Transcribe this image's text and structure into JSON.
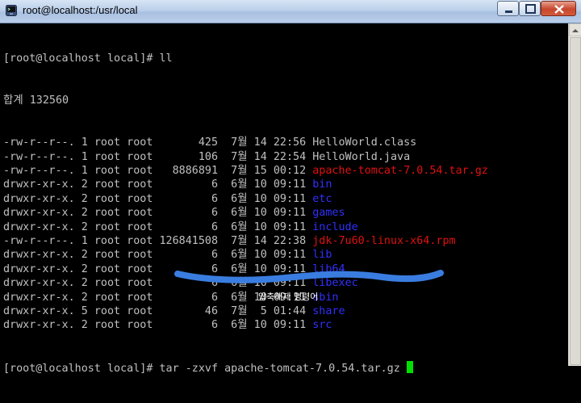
{
  "window": {
    "title": "root@localhost:/usr/local",
    "icons": {
      "app": "terminal-app-icon",
      "minimize": "minimize-icon",
      "maximize": "maximize-icon",
      "close": "close-icon"
    }
  },
  "terminal": {
    "prompt1": "[root@localhost local]# ll",
    "total": "합계 132560",
    "files": [
      {
        "perms": "-rw-r--r--.",
        "links": "1",
        "owner": "root",
        "group": "root",
        "size": "425",
        "month": "7월",
        "day": "14",
        "time": "22:56",
        "name": "HelloWorld.class",
        "kind": "plain"
      },
      {
        "perms": "-rw-r--r--.",
        "links": "1",
        "owner": "root",
        "group": "root",
        "size": "106",
        "month": "7월",
        "day": "14",
        "time": "22:54",
        "name": "HelloWorld.java",
        "kind": "plain"
      },
      {
        "perms": "-rw-r--r--.",
        "links": "1",
        "owner": "root",
        "group": "root",
        "size": "8886891",
        "month": "7월",
        "day": "15",
        "time": "00:12",
        "name": "apache-tomcat-7.0.54.tar.gz",
        "kind": "archive"
      },
      {
        "perms": "drwxr-xr-x.",
        "links": "2",
        "owner": "root",
        "group": "root",
        "size": "6",
        "month": "6월",
        "day": "10",
        "time": "09:11",
        "name": "bin",
        "kind": "dir"
      },
      {
        "perms": "drwxr-xr-x.",
        "links": "2",
        "owner": "root",
        "group": "root",
        "size": "6",
        "month": "6월",
        "day": "10",
        "time": "09:11",
        "name": "etc",
        "kind": "dir"
      },
      {
        "perms": "drwxr-xr-x.",
        "links": "2",
        "owner": "root",
        "group": "root",
        "size": "6",
        "month": "6월",
        "day": "10",
        "time": "09:11",
        "name": "games",
        "kind": "dir"
      },
      {
        "perms": "drwxr-xr-x.",
        "links": "2",
        "owner": "root",
        "group": "root",
        "size": "6",
        "month": "6월",
        "day": "10",
        "time": "09:11",
        "name": "include",
        "kind": "dir"
      },
      {
        "perms": "-rw-r--r--.",
        "links": "1",
        "owner": "root",
        "group": "root",
        "size": "126841508",
        "month": "7월",
        "day": "14",
        "time": "22:38",
        "name": "jdk-7u60-linux-x64.rpm",
        "kind": "archive"
      },
      {
        "perms": "drwxr-xr-x.",
        "links": "2",
        "owner": "root",
        "group": "root",
        "size": "6",
        "month": "6월",
        "day": "10",
        "time": "09:11",
        "name": "lib",
        "kind": "dir"
      },
      {
        "perms": "drwxr-xr-x.",
        "links": "2",
        "owner": "root",
        "group": "root",
        "size": "6",
        "month": "6월",
        "day": "10",
        "time": "09:11",
        "name": "lib64",
        "kind": "dir"
      },
      {
        "perms": "drwxr-xr-x.",
        "links": "2",
        "owner": "root",
        "group": "root",
        "size": "6",
        "month": "6월",
        "day": "10",
        "time": "09:11",
        "name": "libexec",
        "kind": "dir"
      },
      {
        "perms": "drwxr-xr-x.",
        "links": "2",
        "owner": "root",
        "group": "root",
        "size": "6",
        "month": "6월",
        "day": "10",
        "time": "09:11",
        "name": "sbin",
        "kind": "dir"
      },
      {
        "perms": "drwxr-xr-x.",
        "links": "5",
        "owner": "root",
        "group": "root",
        "size": "46",
        "month": "7월",
        "day": "5",
        "time": "01:44",
        "name": "share",
        "kind": "dir"
      },
      {
        "perms": "drwxr-xr-x.",
        "links": "2",
        "owner": "root",
        "group": "root",
        "size": "6",
        "month": "6월",
        "day": "10",
        "time": "09:11",
        "name": "src",
        "kind": "dir"
      }
    ],
    "prompt2": "[root@localhost local]# ",
    "command": "tar -zxvf apache-tomcat-7.0.54.tar.gz"
  },
  "annotation": {
    "caption": "압축해제 명령어",
    "highlight_color": "#3a7de0"
  },
  "colors": {
    "dir": "#3030ff",
    "archive": "#e01010",
    "text": "#c0c0c0",
    "cursor": "#00e000"
  }
}
